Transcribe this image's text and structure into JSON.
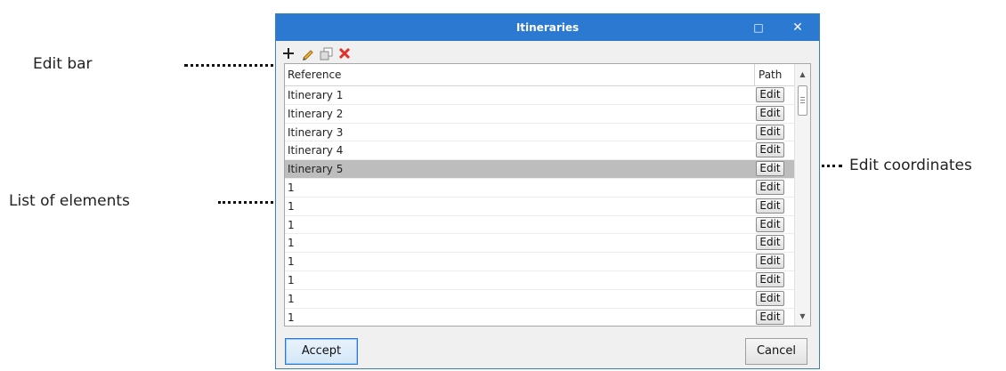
{
  "annotations": {
    "edit_bar": "Edit bar",
    "list_of_elements": "List of elements",
    "edit_coordinates": "Edit coordinates"
  },
  "window": {
    "title": "Itineraries",
    "maximize_glyph": "□",
    "close_glyph": "✕"
  },
  "toolbar": {
    "icons": [
      "add-icon",
      "edit-pencil-icon",
      "duplicate-icon",
      "delete-icon"
    ],
    "colors": {
      "delete": "#e0302a",
      "pencil": "#e6a21a"
    }
  },
  "table": {
    "headers": {
      "reference": "Reference",
      "path": "Path"
    },
    "edit_label": "Edit",
    "selected_row": 4,
    "rows": [
      "Itinerary 1",
      "Itinerary 2",
      "Itinerary 3",
      "Itinerary 4",
      "Itinerary 5",
      "1",
      "1",
      "1",
      "1",
      "1",
      "1",
      "1",
      "1"
    ]
  },
  "footer": {
    "accept_label": "Accept",
    "cancel_label": "Cancel"
  },
  "colors": {
    "titlebar": "#2b79d0",
    "selected_row": "#bdbdbd"
  }
}
